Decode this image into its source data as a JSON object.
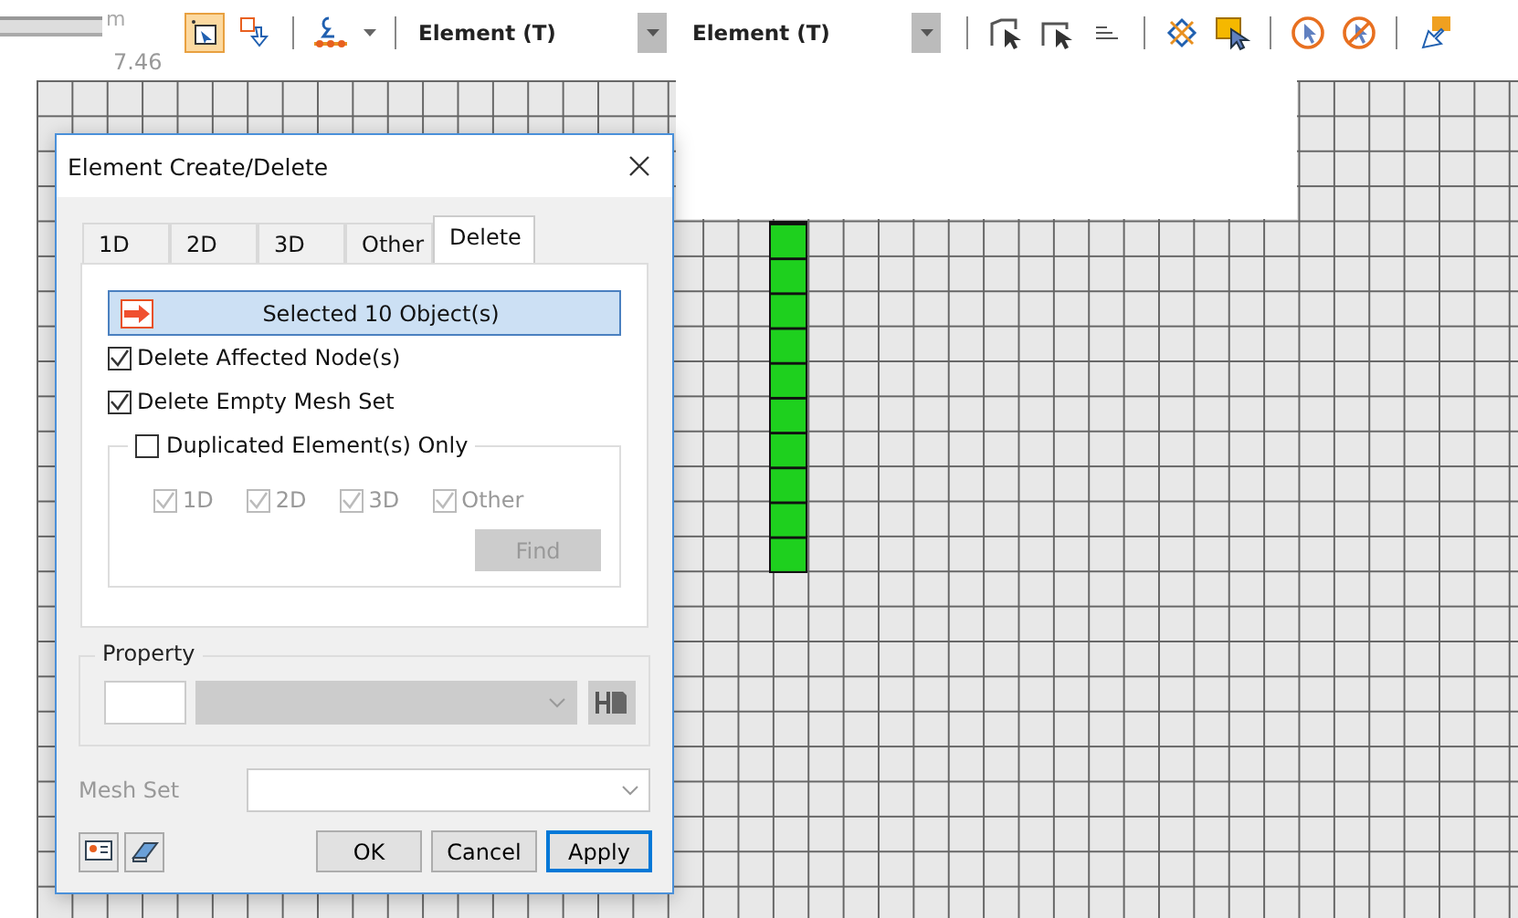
{
  "toolbar": {
    "scale_unit": "m",
    "scale_value": "7.46",
    "first_tool_active": true,
    "dropdowns": [
      {
        "value": "Element (T)"
      },
      {
        "value": "Element (T)"
      }
    ]
  },
  "dialog": {
    "title": "Element Create/Delete",
    "tabs": [
      {
        "label": "1D",
        "selected": false
      },
      {
        "label": "2D",
        "selected": false
      },
      {
        "label": "3D",
        "selected": false
      },
      {
        "label": "Other",
        "selected": false
      },
      {
        "label": "Delete",
        "selected": true
      }
    ],
    "selection_button": "Selected 10 Object(s)",
    "options": [
      {
        "label": "Delete Affected Node(s)",
        "checked": true
      },
      {
        "label": "Delete Empty Mesh Set",
        "checked": true
      }
    ],
    "duplicated": {
      "label": "Duplicated Element(s) Only",
      "checked": false,
      "types": [
        {
          "label": "1D",
          "checked": true,
          "disabled": true
        },
        {
          "label": "2D",
          "checked": true,
          "disabled": true
        },
        {
          "label": "3D",
          "checked": true,
          "disabled": true
        },
        {
          "label": "Other",
          "checked": true,
          "disabled": true
        }
      ],
      "find_button": {
        "label": "Find",
        "disabled": true
      }
    },
    "property": {
      "legend": "Property",
      "disabled": true
    },
    "mesh_set": {
      "label": "Mesh Set",
      "disabled": true
    },
    "buttons": [
      {
        "label": "OK",
        "focused": false
      },
      {
        "label": "Cancel",
        "focused": false
      },
      {
        "label": "Apply",
        "focused": true
      }
    ]
  }
}
